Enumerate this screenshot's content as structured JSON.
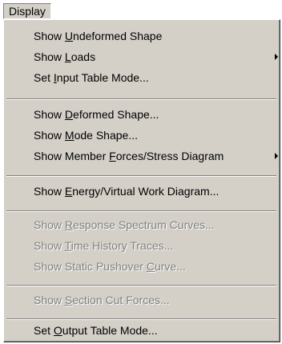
{
  "menu_title": "Display",
  "items": [
    {
      "pre": "Show ",
      "key": "U",
      "post": "ndeformed Shape"
    },
    {
      "pre": "Show ",
      "key": "L",
      "post": "oads"
    },
    {
      "pre": "Set ",
      "key": "I",
      "post": "nput Table Mode..."
    },
    {
      "pre": "Show  ",
      "key": "D",
      "post": "eformed Shape..."
    },
    {
      "pre": "Show  ",
      "key": "M",
      "post": "ode Shape..."
    },
    {
      "pre": "Show Member ",
      "key": "F",
      "post": "orces/Stress Diagram"
    },
    {
      "pre": "Show ",
      "key": "E",
      "post": "nergy/Virtual Work Diagram..."
    },
    {
      "pre": "Show ",
      "key": "R",
      "post": "esponse Spectrum Curves..."
    },
    {
      "pre": "Show ",
      "key": "T",
      "post": "ime History Traces..."
    },
    {
      "pre": "Show Static Pushover ",
      "key": "C",
      "post": "urve..."
    },
    {
      "pre": "Show ",
      "key": "S",
      "post": "ection Cut Forces..."
    },
    {
      "pre": "Set ",
      "key": "O",
      "post": "utput Table Mode..."
    }
  ]
}
